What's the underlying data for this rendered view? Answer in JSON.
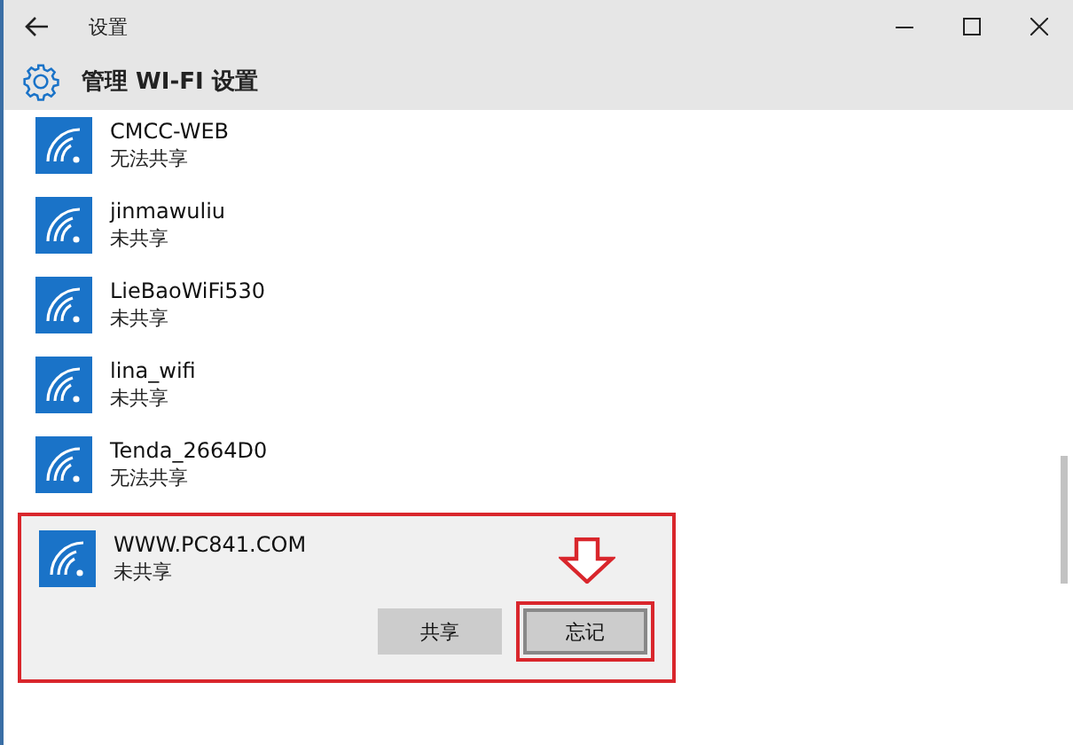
{
  "window": {
    "title": "设置"
  },
  "header": {
    "title": "管理 WI-FI 设置"
  },
  "networks": [
    {
      "name": "CMCC-WEB",
      "status": "无法共享",
      "selected": false
    },
    {
      "name": "jinmawuliu",
      "status": "未共享",
      "selected": false
    },
    {
      "name": "LieBaoWiFi530",
      "status": "未共享",
      "selected": false
    },
    {
      "name": "lina_wifi",
      "status": "未共享",
      "selected": false
    },
    {
      "name": "Tenda_2664D0",
      "status": "无法共享",
      "selected": false
    },
    {
      "name": "WWW.PC841.COM",
      "status": "未共享",
      "selected": true,
      "actions": [
        {
          "label": "共享",
          "highlighted": false
        },
        {
          "label": "忘记",
          "highlighted": true
        }
      ]
    }
  ]
}
